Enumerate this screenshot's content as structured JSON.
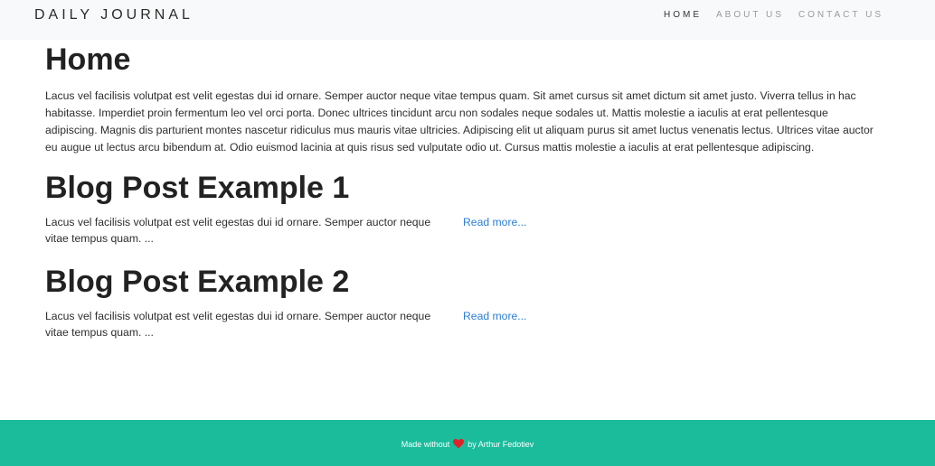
{
  "navbar": {
    "brand": "DAILY JOURNAL",
    "links": [
      {
        "label": "HOME"
      },
      {
        "label": "ABOUT US"
      },
      {
        "label": "CONTACT US"
      }
    ]
  },
  "home": {
    "title": "Home",
    "content": "Lacus vel facilisis volutpat est velit egestas dui id ornare. Semper auctor neque vitae tempus quam. Sit amet cursus sit amet dictum sit amet justo. Viverra tellus in hac habitasse. Imperdiet proin fermentum leo vel orci porta. Donec ultrices tincidunt arcu non sodales neque sodales ut. Mattis molestie a iaculis at erat pellentesque adipiscing. Magnis dis parturient montes nascetur ridiculus mus mauris vitae ultricies. Adipiscing elit ut aliquam purus sit amet luctus venenatis lectus. Ultrices vitae auctor eu augue ut lectus arcu bibendum at. Odio euismod lacinia at quis risus sed vulputate odio ut. Cursus mattis molestie a iaculis at erat pellentesque adipiscing."
  },
  "posts": [
    {
      "title": "Blog Post Example 1",
      "excerpt": "Lacus vel facilisis volutpat est velit egestas dui id ornare. Semper auctor neque vitae tempus quam. ...",
      "read_more": "Read more..."
    },
    {
      "title": "Blog Post Example 2",
      "excerpt": "Lacus vel facilisis volutpat est velit egestas dui id ornare. Semper auctor neque vitae tempus quam. ...",
      "read_more": "Read more..."
    }
  ],
  "footer": {
    "made_without": "Made without",
    "heart_icon": "heart-icon",
    "heart_color": "#e0232a",
    "by_author": "by Arthur Fedotiev"
  },
  "colors": {
    "navbar_bg": "#f8f9fa",
    "footer_bg": "#1abc9c",
    "link": "#2b7fd6"
  }
}
